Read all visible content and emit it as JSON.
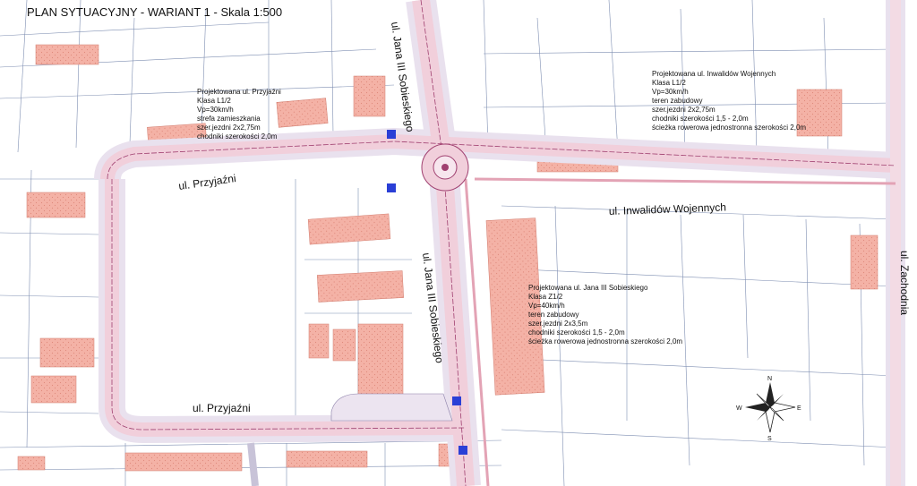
{
  "title": "PLAN SYTUACYJNY - WARIANT 1 - Skala 1:500",
  "streets": {
    "przyjazni_upper": "ul. Przyjaźni",
    "przyjazni_lower": "ul. Przyjaźni",
    "sobieskiego_north": "ul. Jana III Sobieskiego",
    "sobieskiego_south": "ul. Jana III Sobieskiego",
    "inwalidow": "ul. Inwalidów Wojennych",
    "zachodnia": "ul. Zachodnia"
  },
  "notes": {
    "przyjazni": [
      "Projektowana ul. Przyjaźni",
      "Klasa L1/2",
      "Vp=30km/h",
      "strefa zamieszkania",
      "szer.jezdni 2x2,75m",
      "chodniki szerokości 2,0m"
    ],
    "inwalidow": [
      "Projektowana ul. Inwalidów Wojennych",
      "Klasa L1/2",
      "Vp=30km/h",
      "teren zabudowy",
      "szer.jezdni 2x2,75m",
      "chodniki szerokości 1,5 - 2,0m",
      "ścieżka rowerowa jednostronna szerokości 2,0m"
    ],
    "sobieskiego": [
      "Projektowana ul. Jana III Sobieskiego",
      "Klasa Z1/2",
      "Vp=40km/h",
      "teren zabudowy",
      "szer.jezdni 2x3,5m",
      "chodniki szerokości 1,5 - 2,0m",
      "ścieżka rowerowa jednostronna szerokości 2,0m"
    ]
  },
  "compass": {
    "north": "N",
    "east": "E",
    "south": "S",
    "west": "W"
  },
  "colors": {
    "building": "#f2aaa0",
    "road": "#f1d2dc",
    "road_edge": "#a04070",
    "parcel_line": "#6b7fa6",
    "sidewalk": "#e7e1ea",
    "sign": "#2a3fd6"
  }
}
